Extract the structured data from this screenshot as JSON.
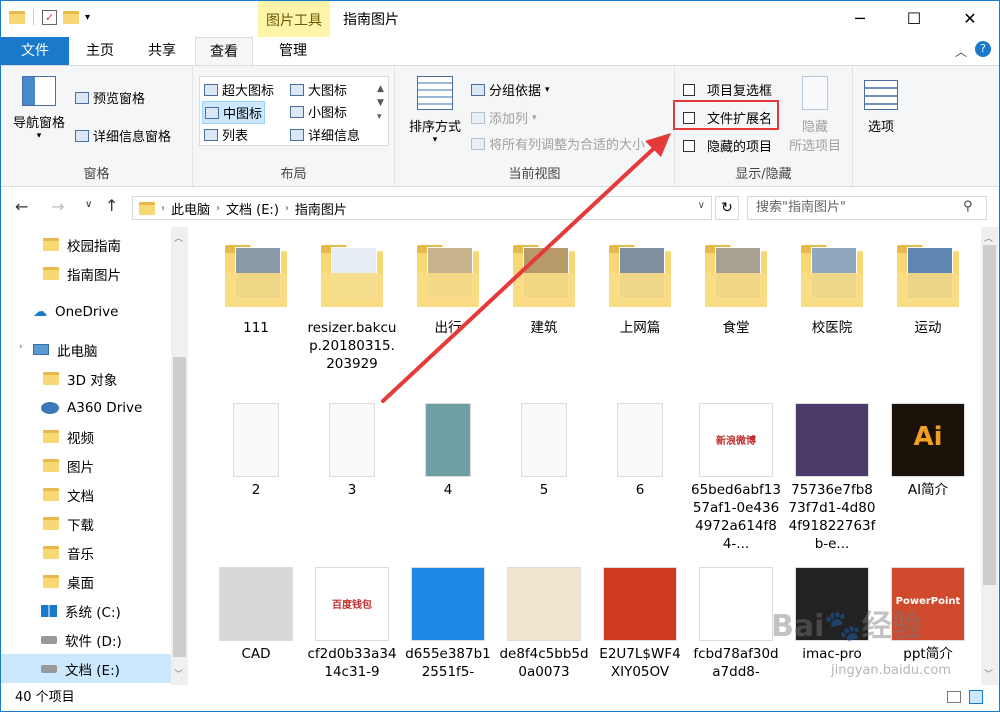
{
  "title_bar": {
    "context_tab": "图片工具",
    "window_title": "指南图片"
  },
  "tabs": [
    {
      "label": "文件"
    },
    {
      "label": "主页"
    },
    {
      "label": "共享"
    },
    {
      "label": "查看"
    },
    {
      "label": "管理"
    }
  ],
  "ribbon": {
    "pane": {
      "nav_pane": "导航窗格",
      "preview": "预览窗格",
      "details": "详细信息窗格",
      "label": "窗格"
    },
    "layout": {
      "items": [
        "超大图标",
        "大图标",
        "中图标",
        "小图标",
        "列表",
        "详细信息"
      ],
      "label": "布局"
    },
    "current_view": {
      "sort": "排序方式",
      "group": "分组依据",
      "add_col": "添加列",
      "fit_cols": "将所有列调整为合适的大小",
      "label": "当前视图"
    },
    "show_hide": {
      "item_checkbox": "项目复选框",
      "file_ext": "文件扩展名",
      "hidden_items": "隐藏的项目",
      "hide": "隐藏",
      "selected_items": "所选项目",
      "label": "显示/隐藏"
    },
    "options": "选项"
  },
  "address": {
    "segments": [
      "此电脑",
      "文档 (E:)",
      "指南图片"
    ],
    "search_placeholder": "搜索\"指南图片\""
  },
  "sidebar": [
    {
      "label": "校园指南"
    },
    {
      "label": "指南图片"
    },
    {
      "label": "OneDrive"
    },
    {
      "label": "此电脑"
    },
    {
      "label": "3D 对象"
    },
    {
      "label": "A360 Drive"
    },
    {
      "label": "视频"
    },
    {
      "label": "图片"
    },
    {
      "label": "文档"
    },
    {
      "label": "下载"
    },
    {
      "label": "音乐"
    },
    {
      "label": "桌面"
    },
    {
      "label": "系统 (C:)"
    },
    {
      "label": "软件 (D:)"
    },
    {
      "label": "文档 (E:)"
    }
  ],
  "files": [
    {
      "name": "111",
      "kind": "folder"
    },
    {
      "name": "resizer.bakcup.20180315.203929",
      "kind": "folder"
    },
    {
      "name": "出行",
      "kind": "folder"
    },
    {
      "name": "建筑",
      "kind": "folder"
    },
    {
      "name": "上网篇",
      "kind": "folder"
    },
    {
      "name": "食堂",
      "kind": "folder"
    },
    {
      "name": "校医院",
      "kind": "folder"
    },
    {
      "name": "运动",
      "kind": "folder"
    },
    {
      "name": "2",
      "kind": "image"
    },
    {
      "name": "3",
      "kind": "image"
    },
    {
      "name": "4",
      "kind": "image"
    },
    {
      "name": "5",
      "kind": "image"
    },
    {
      "name": "6",
      "kind": "image"
    },
    {
      "name": "65bed6abf1357af1-0e4364972a614f84-...",
      "kind": "image"
    },
    {
      "name": "75736e7fb873f7d1-4d804f91822763fb-e...",
      "kind": "image"
    },
    {
      "name": "AI简介",
      "kind": "image"
    },
    {
      "name": "CAD",
      "kind": "image"
    },
    {
      "name": "cf2d0b33a3414c31-9",
      "kind": "image"
    },
    {
      "name": "d655e387b12551f5-",
      "kind": "image"
    },
    {
      "name": "de8f4c5bb5d0a0073",
      "kind": "image"
    },
    {
      "name": "E2U7L$WF4XIY05OV",
      "kind": "image"
    },
    {
      "name": "fcbd78af30da7dd8-",
      "kind": "image"
    },
    {
      "name": "imac-pro",
      "kind": "image"
    },
    {
      "name": "ppt简介",
      "kind": "image"
    }
  ],
  "status": {
    "count": "40 个项目"
  },
  "thumb_text": {
    "sina": "新浪微博",
    "baidu": "百度钱包",
    "ai": "Ai",
    "ppt": "PowerPoint"
  },
  "watermark": {
    "brand": "Bai",
    "brand2": "经验",
    "url": "jingyan.baidu.com"
  },
  "colors": {
    "accent": "#1979ca",
    "context_tab": "#fff5a8",
    "annotation_red": "#e53a3a"
  }
}
